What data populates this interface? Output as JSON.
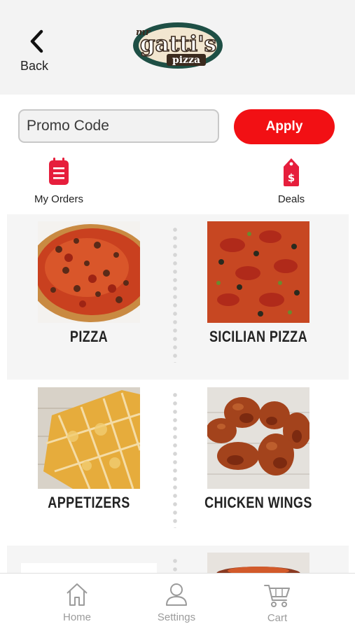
{
  "header": {
    "back_label": "Back",
    "brand_top": "mr",
    "brand_main": "gatti's",
    "brand_sub": "pizza"
  },
  "promo": {
    "placeholder": "Promo Code",
    "apply_label": "Apply"
  },
  "quick_links": [
    {
      "label": "My Orders",
      "icon": "orders-clipboard-icon"
    },
    {
      "label": "Deals",
      "icon": "price-tag-icon"
    }
  ],
  "categories": [
    {
      "name": "PIZZA"
    },
    {
      "name": "SICILIAN PIZZA"
    },
    {
      "name": "APPETIZERS"
    },
    {
      "name": "CHICKEN WINGS"
    }
  ],
  "tabbar": {
    "items": [
      {
        "label": "Home",
        "icon": "home-icon"
      },
      {
        "label": "Settings",
        "icon": "person-icon"
      },
      {
        "label": "Cart",
        "icon": "cart-icon"
      }
    ]
  },
  "colors": {
    "accent": "#f21014",
    "header_bg": "#f3f3f3",
    "tab_label": "#9b9b9b"
  }
}
